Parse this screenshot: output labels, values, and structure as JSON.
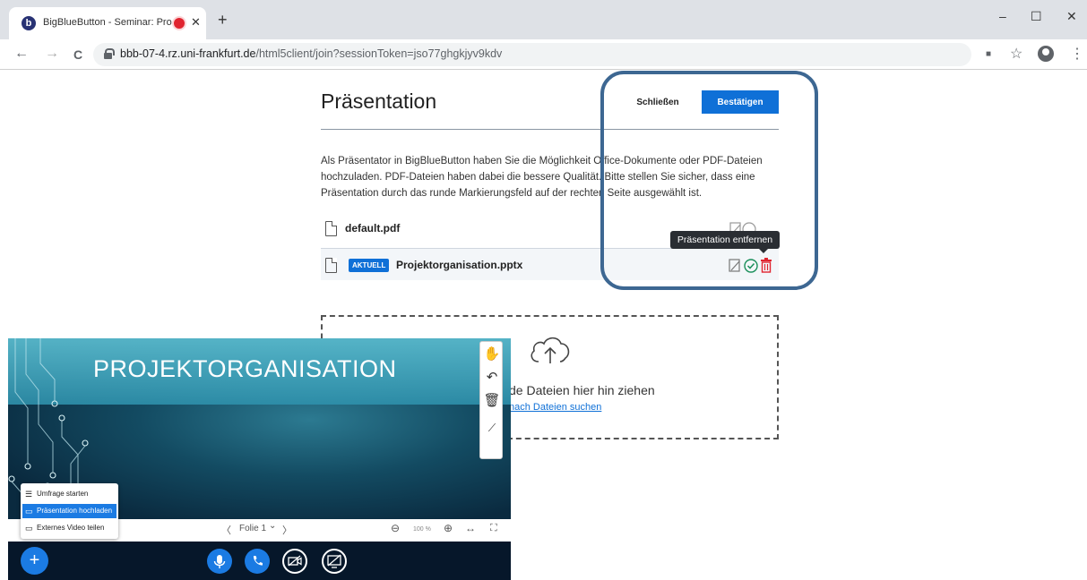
{
  "browser": {
    "tab_title": "BigBlueButton - Seminar: Pro",
    "favicon_letter": "b",
    "tab_close": "✕",
    "new_tab": "+",
    "window_controls": {
      "minimize": "–",
      "maximize": "☐",
      "close": "✕"
    },
    "nav": {
      "back": "←",
      "forward": "→",
      "reload": "C"
    },
    "url_host": "bbb-07-4.rz.uni-frankfurt.de",
    "url_path": "/html5client/join?sessionToken=jso77ghgkjyv9kdv",
    "toolbar_icons": {
      "camera": "■",
      "star": "☆",
      "menu": "⋮"
    }
  },
  "modal": {
    "title": "Präsentation",
    "close_label": "Schließen",
    "confirm_label": "Bestätigen",
    "description": "Als Präsentator in BigBlueButton haben Sie die Möglichkeit Office-Dokumente oder PDF-Dateien hochzuladen. PDF-Dateien haben dabei die bessere Qualität. Bitte stellen Sie sicher, dass eine Präsentation durch das runde Markierungsfeld auf der rechten Seite ausgewählt ist.",
    "files": [
      {
        "name": "default.pdf",
        "current": false
      },
      {
        "name": "Projektorganisation.pptx",
        "current": true
      }
    ],
    "current_badge": "AKTUELL",
    "tooltip": "Präsentation entfernen",
    "dropzone_text": "de Dateien hier hin ziehen",
    "dropzone_link": "nach Dateien suchen"
  },
  "client": {
    "slide_title": "PROJEKTORGANISATION",
    "slide_controls": {
      "prev": "〈",
      "slide_label": "Folie 1",
      "dropdown": "⌄",
      "next": "〉",
      "zoom_out": "⊖",
      "zoom": "100 %",
      "zoom_in": "⊕",
      "fit_width": "↔",
      "fullscreen": "⛶"
    },
    "menu": [
      {
        "label": "Umfrage starten",
        "icon": "☰"
      },
      {
        "label": "Präsentation hochladen",
        "icon": "▭"
      },
      {
        "label": "Externes Video teilen",
        "icon": "▭"
      }
    ],
    "plus": "+"
  },
  "colors": {
    "accent": "#0f70d7",
    "highlight_ring": "#3d6792",
    "delete_red": "#e0242f",
    "check_green": "#1a8f5a",
    "client_bg": "#06172a"
  }
}
